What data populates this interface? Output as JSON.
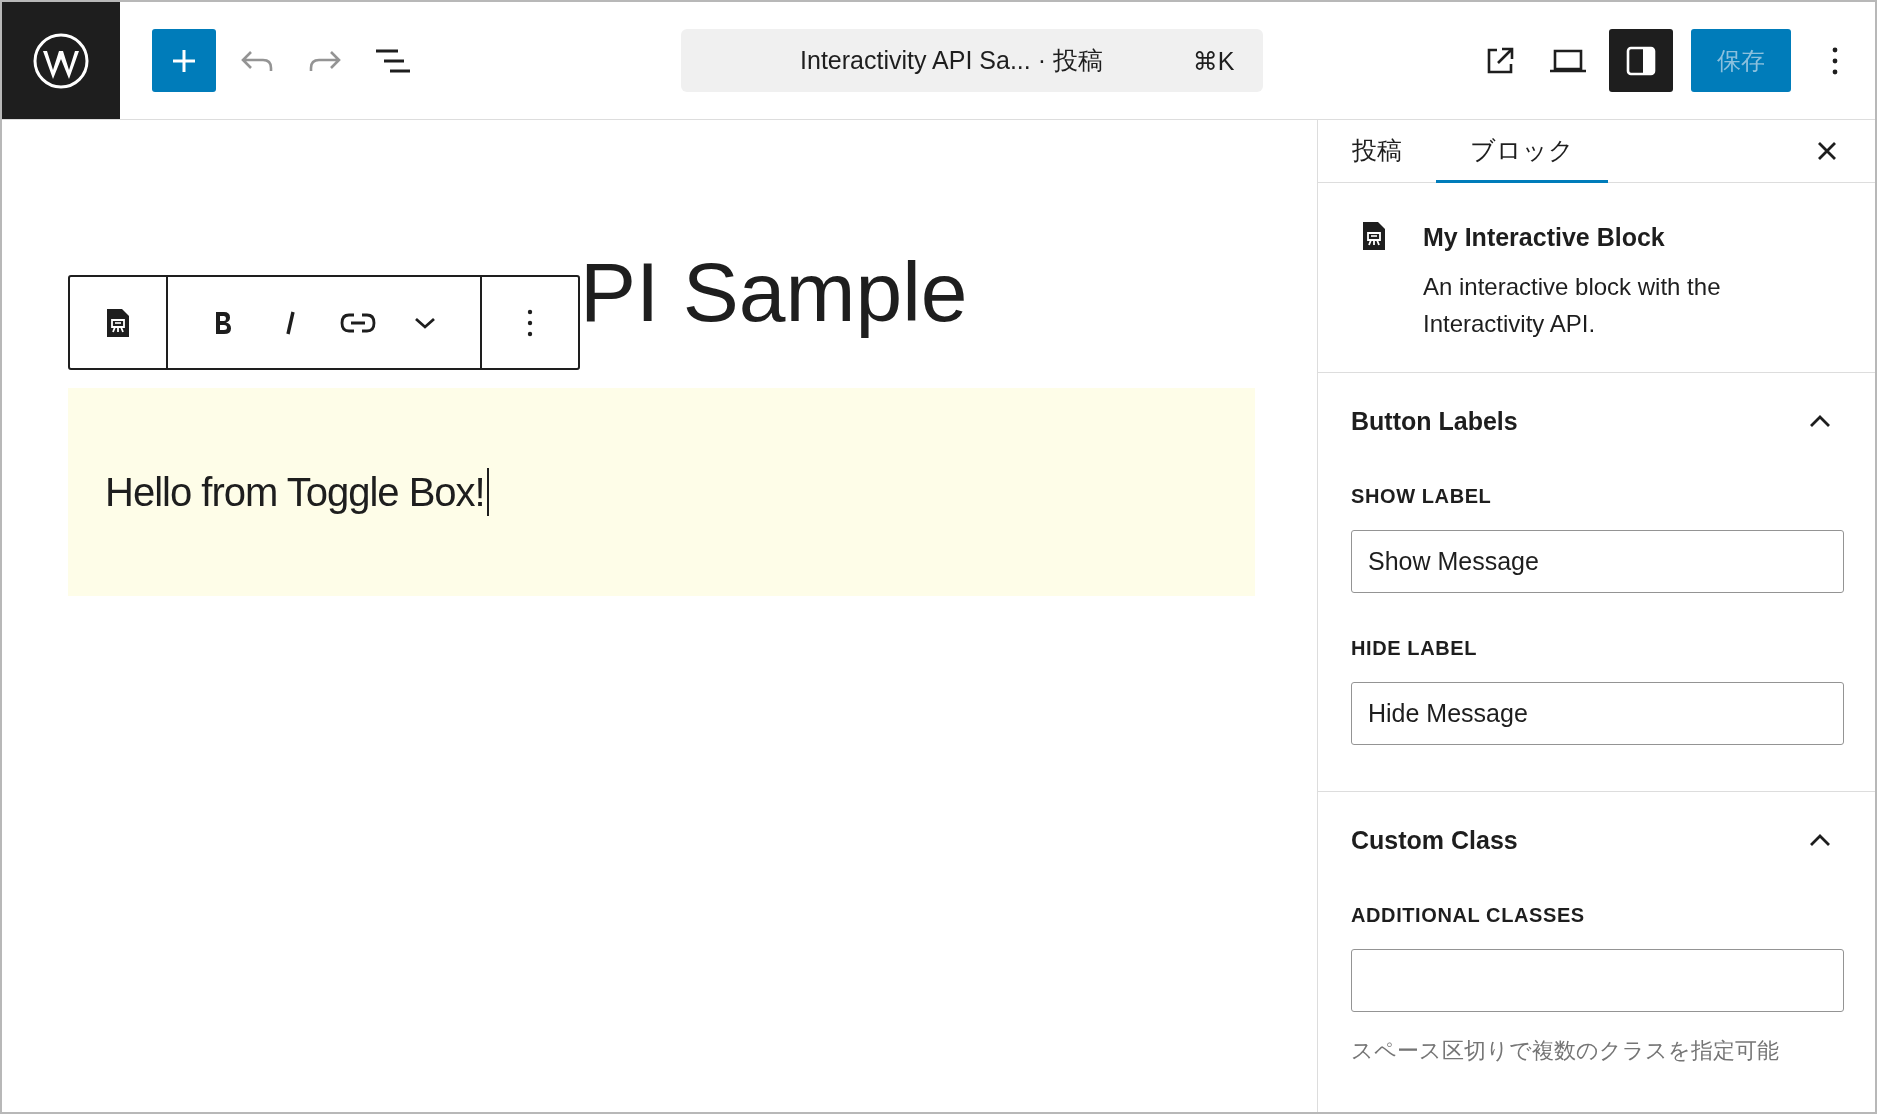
{
  "header": {
    "undo": {
      "disabled": true
    },
    "redo": {
      "disabled": true
    },
    "command_bar": {
      "title": "Interactivity API Sa... · 投稿",
      "shortcut": "⌘K"
    },
    "settings_toggle": {
      "pressed": true
    },
    "save_button": {
      "label": "保存",
      "disabled": true
    }
  },
  "editor": {
    "post_title": "PI Sample",
    "paragraph": "Hello from Toggle Box!"
  },
  "sidebar": {
    "tabs": [
      {
        "label": "投稿",
        "selected": false
      },
      {
        "label": "ブロック",
        "selected": true
      }
    ],
    "block_card": {
      "title": "My Interactive Block",
      "description": "An interactive block with the Interactivity API."
    },
    "panels": [
      {
        "title": "Button Labels",
        "expanded": true,
        "fields": [
          {
            "label": "SHOW LABEL",
            "value": "Show Message"
          },
          {
            "label": "HIDE LABEL",
            "value": "Hide Message"
          }
        ]
      },
      {
        "title": "Custom Class",
        "expanded": true,
        "fields": [
          {
            "label": "ADDITIONAL CLASSES",
            "help": "スペース区切りで複数のクラスを指定可能"
          }
        ]
      }
    ]
  }
}
